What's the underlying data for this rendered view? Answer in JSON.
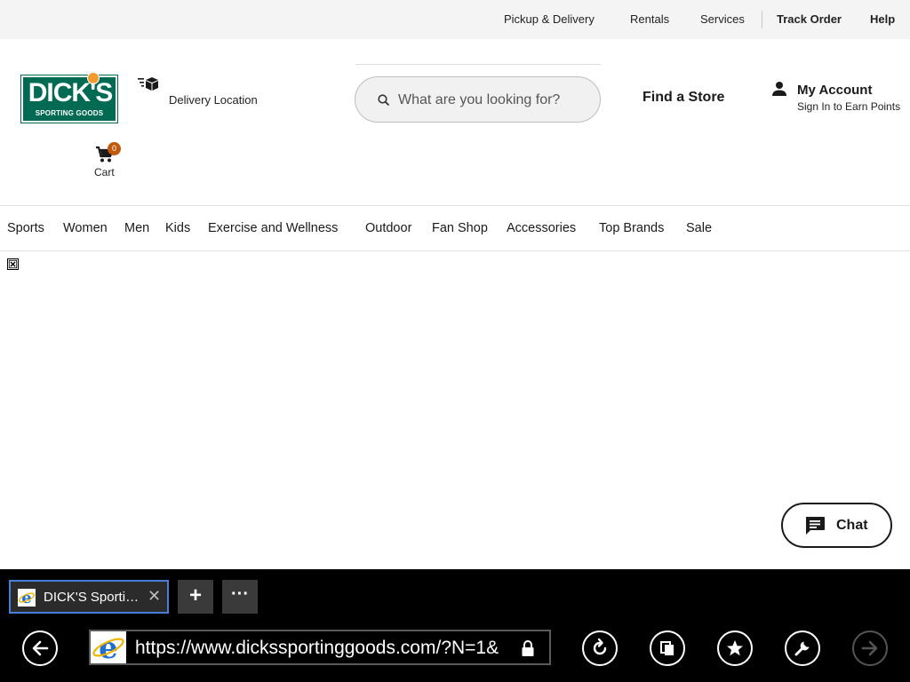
{
  "utility_bar": {
    "pickup_delivery": "Pickup & Delivery",
    "rentals": "Rentals",
    "services": "Services",
    "track_order": "Track Order",
    "help": "Help"
  },
  "header": {
    "logo_main": "DICK'S",
    "logo_sub": "SPORTING GOODS",
    "delivery_label": "Delivery Location",
    "cart_count": "0",
    "cart_label": "Cart",
    "search_placeholder": "What are you looking for?",
    "find_store": "Find a Store",
    "account_title": "My Account",
    "account_sub": "Sign In to Earn Points"
  },
  "nav": {
    "items": [
      "Sports",
      "Women",
      "Men",
      "Kids",
      "Exercise and Wellness",
      "Outdoor",
      "Fan Shop",
      "Accessories",
      "Top Brands",
      "Sale"
    ]
  },
  "chat": {
    "label": "Chat"
  },
  "browser": {
    "tab_title": "DICK'S Sporting Goods",
    "tab_close": "✕",
    "new_tab": "+",
    "tab_menu": "···",
    "url": "https://www.dickssportinggoods.com/?N=1&"
  },
  "colors": {
    "brand_green": "#006a52",
    "badge_orange": "#c0590c",
    "tab_border": "#4a7fd8",
    "chrome_bg": "#000000"
  },
  "icons": [
    "delivery-box-icon",
    "cart-icon",
    "search-icon",
    "account-icon",
    "chat-bubble-icon",
    "ie-logo-icon",
    "back-arrow-icon",
    "refresh-icon",
    "tabs-icon",
    "favorites-star-icon",
    "tools-wrench-icon",
    "forward-arrow-icon",
    "lock-icon"
  ]
}
